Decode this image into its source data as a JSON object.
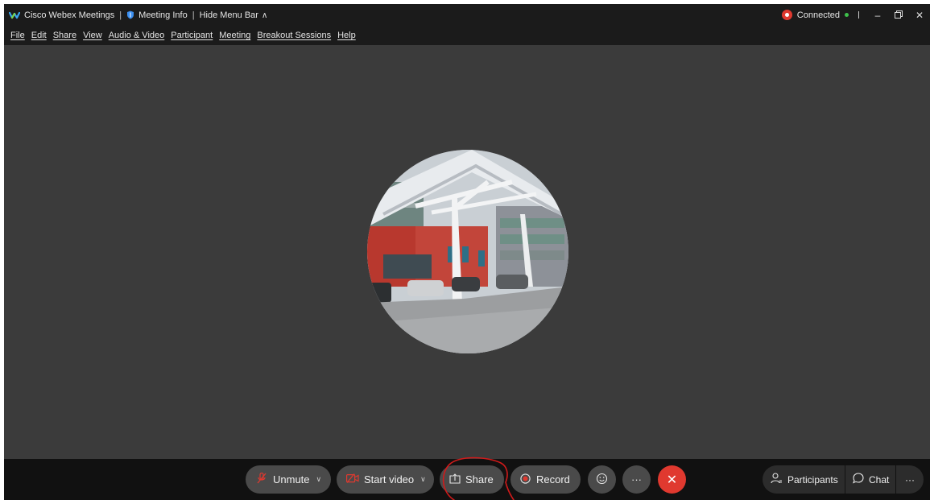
{
  "titlebar": {
    "app_title": "Cisco Webex Meetings",
    "meeting_info": "Meeting Info",
    "hide_menu_bar": "Hide Menu Bar",
    "connection_status": "Connected"
  },
  "menubar": {
    "items": [
      "File",
      "Edit",
      "Share",
      "View",
      "Audio & Video",
      "Participant",
      "Meeting",
      "Breakout Sessions",
      "Help"
    ]
  },
  "controls": {
    "unmute": "Unmute",
    "start_video": "Start video",
    "share": "Share",
    "record": "Record",
    "participants": "Participants",
    "chat": "Chat",
    "more": "···"
  },
  "colors": {
    "stage": "#3b3b3b",
    "bar": "#111111",
    "accent_red": "#e0392f",
    "connected_green": "#3ec14b",
    "annotation_red": "#d11a1a"
  },
  "icons": [
    "webex-logo-icon",
    "shield-icon",
    "chevron-up-icon",
    "record-dot-icon",
    "minimize-icon",
    "restore-icon",
    "close-icon",
    "microphone-muted-icon",
    "camera-off-icon",
    "share-icon",
    "record-icon",
    "reactions-icon",
    "more-icon",
    "end-call-icon",
    "participants-icon",
    "chat-icon"
  ]
}
